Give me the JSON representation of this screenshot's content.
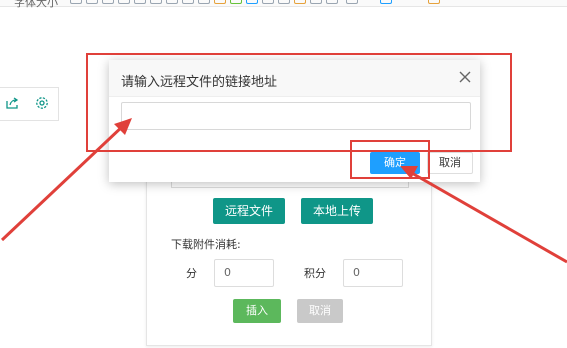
{
  "toolbar": {
    "truncated_label": "字体大小"
  },
  "modal": {
    "title": "请输入远程文件的链接地址",
    "input_value": "",
    "confirm_label": "确定",
    "cancel_label": "取消"
  },
  "main_dialog": {
    "remote_file_button": "远程文件",
    "local_upload_button": "本地上传",
    "consume_label": "下载附件消耗:",
    "fen_label": "分",
    "fen_value": "0",
    "jifen_label": "积分",
    "jifen_value": "0",
    "insert_button": "插入",
    "cancel_button": "取消"
  },
  "colors": {
    "annotation_red": "#e0403a",
    "teal": "#0f9688",
    "confirm_blue": "#1e9fff",
    "insert_green": "#5cb85c"
  },
  "icons": [
    "share-icon",
    "gear-icon",
    "close-icon"
  ]
}
